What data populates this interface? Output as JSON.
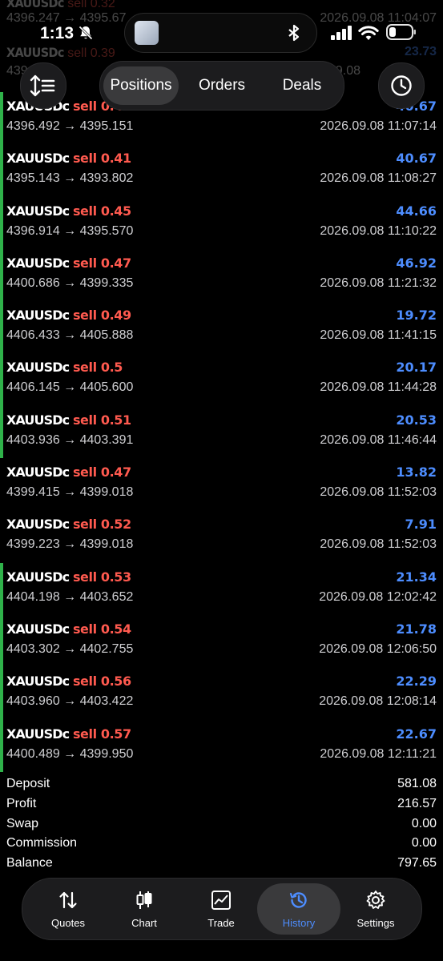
{
  "status_bar": {
    "time": "1:13"
  },
  "ghost_rows": [
    {
      "symbol": "XAUUSDc",
      "side": "sell 0.32",
      "prices": "4396.247 → 4395.67",
      "profit": "",
      "time": "2026.09.08 11:04:07"
    },
    {
      "symbol": "XAUUSDc",
      "side": "sell 0.39",
      "prices": "439",
      "profit": "23.73",
      "time": "26.09.08"
    }
  ],
  "toolbar": {
    "tabs": [
      "Positions",
      "Orders",
      "Deals"
    ],
    "active_tab": "Positions"
  },
  "deals": [
    {
      "symbol": "XAUUSDc",
      "side": "sell 0.41",
      "prices": "4396.492 → 4395.151",
      "profit": "40.67",
      "time": "2026.09.08 11:07:14",
      "marker": true
    },
    {
      "symbol": "XAUUSDc",
      "side": "sell 0.41",
      "prices": "4395.143 → 4393.802",
      "profit": "40.67",
      "time": "2026.09.08 11:08:27",
      "marker": true
    },
    {
      "symbol": "XAUUSDc",
      "side": "sell 0.45",
      "prices": "4396.914 → 4395.570",
      "profit": "44.66",
      "time": "2026.09.08 11:10:22",
      "marker": true
    },
    {
      "symbol": "XAUUSDc",
      "side": "sell 0.47",
      "prices": "4400.686 → 4399.335",
      "profit": "46.92",
      "time": "2026.09.08 11:21:32",
      "marker": true
    },
    {
      "symbol": "XAUUSDc",
      "side": "sell 0.49",
      "prices": "4406.433 → 4405.888",
      "profit": "19.72",
      "time": "2026.09.08 11:41:15",
      "marker": true
    },
    {
      "symbol": "XAUUSDc",
      "side": "sell 0.5",
      "prices": "4406.145 → 4405.600",
      "profit": "20.17",
      "time": "2026.09.08 11:44:28",
      "marker": true
    },
    {
      "symbol": "XAUUSDc",
      "side": "sell 0.51",
      "prices": "4403.936 → 4403.391",
      "profit": "20.53",
      "time": "2026.09.08 11:46:44",
      "marker": true
    },
    {
      "symbol": "XAUUSDc",
      "side": "sell 0.47",
      "prices": "4399.415 → 4399.018",
      "profit": "13.82",
      "time": "2026.09.08 11:52:03",
      "marker": false
    },
    {
      "symbol": "XAUUSDc",
      "side": "sell 0.52",
      "prices": "4399.223 → 4399.018",
      "profit": "7.91",
      "time": "2026.09.08 11:52:03",
      "marker": false
    },
    {
      "symbol": "XAUUSDc",
      "side": "sell 0.53",
      "prices": "4404.198 → 4403.652",
      "profit": "21.34",
      "time": "2026.09.08 12:02:42",
      "marker": true
    },
    {
      "symbol": "XAUUSDc",
      "side": "sell 0.54",
      "prices": "4403.302 → 4402.755",
      "profit": "21.78",
      "time": "2026.09.08 12:06:50",
      "marker": true
    },
    {
      "symbol": "XAUUSDc",
      "side": "sell 0.56",
      "prices": "4403.960 → 4403.422",
      "profit": "22.29",
      "time": "2026.09.08 12:08:14",
      "marker": true
    },
    {
      "symbol": "XAUUSDc",
      "side": "sell 0.57",
      "prices": "4400.489 → 4399.950",
      "profit": "22.67",
      "time": "2026.09.08 12:11:21",
      "marker": true
    }
  ],
  "summary": [
    {
      "label": "Deposit",
      "value": "581.08"
    },
    {
      "label": "Profit",
      "value": "216.57"
    },
    {
      "label": "Swap",
      "value": "0.00"
    },
    {
      "label": "Commission",
      "value": "0.00"
    },
    {
      "label": "Balance",
      "value": "797.65"
    }
  ],
  "nav": {
    "items": [
      {
        "label": "Quotes",
        "icon": "quotes-arrows-icon"
      },
      {
        "label": "Chart",
        "icon": "candlestick-icon"
      },
      {
        "label": "Trade",
        "icon": "trade-chart-icon"
      },
      {
        "label": "History",
        "icon": "history-clock-icon"
      },
      {
        "label": "Settings",
        "icon": "gear-icon"
      }
    ],
    "active": "History"
  },
  "colors": {
    "sell": "#ff5a4f",
    "profit": "#4d8dff",
    "marker": "#2fb24a",
    "active_nav": "#4d8dff"
  }
}
